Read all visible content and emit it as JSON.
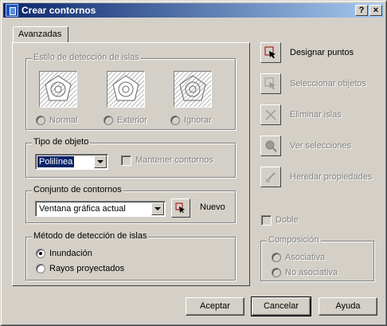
{
  "window": {
    "title": "Crear contornos",
    "help_btn": "?",
    "close_btn": "×"
  },
  "tabs": [
    "Avanzadas"
  ],
  "island_style": {
    "title": "Estilo de detección de islas",
    "options": [
      "Normal",
      "Exterior",
      "Ignorar"
    ]
  },
  "object_type": {
    "title": "Tipo de objeto",
    "selected": "Polilínea",
    "keep_boundaries_label": "Mantener contornos"
  },
  "boundary_set": {
    "title": "Conjunto de contornos",
    "selected": "Ventana gráfica actual",
    "new_label": "Nuevo"
  },
  "island_method": {
    "title": "Método de detección de islas",
    "options": [
      "Inundación",
      "Rayos proyectados"
    ],
    "selected_index": 0
  },
  "actions": {
    "pick_points": "Designar puntos",
    "select_objects": "Seleccionar objetos",
    "remove_islands": "Eliminar islas",
    "view_selections": "Ver selecciones",
    "inherit_properties": "Heredar propiedades"
  },
  "double_label": "Doble",
  "composition": {
    "title": "Composición",
    "options": [
      "Asociativa",
      "No asociativa"
    ]
  },
  "buttons": {
    "accept": "Aceptar",
    "cancel": "Cancelar",
    "help": "Ayuda"
  }
}
